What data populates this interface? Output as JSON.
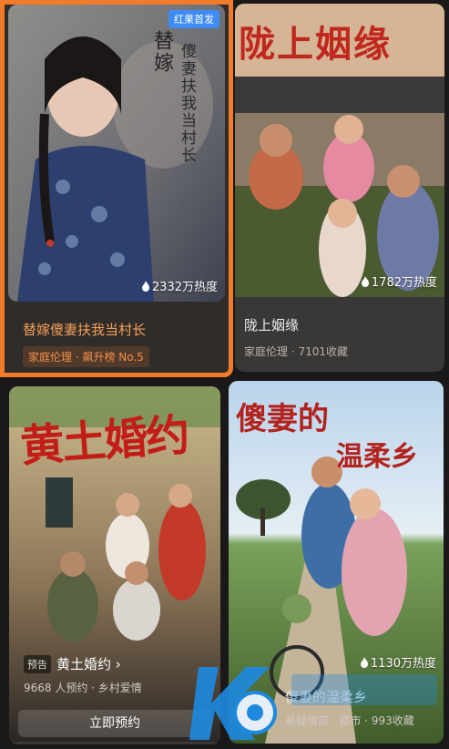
{
  "cards": [
    {
      "badge": "红果首发",
      "poster_title": "替嫁",
      "poster_subtitle": "傻妻扶我当村长",
      "heat": "2332万热度",
      "title": "替嫁傻妻扶我当村长",
      "meta": "家庭伦理 · 飙升榜 No.5"
    },
    {
      "poster_title": "陇上姻缘",
      "heat": "1782万热度",
      "title": "陇上姻缘",
      "meta": "家庭伦理 · 7101收藏"
    },
    {
      "poster_title": "黄土婚约",
      "tag": "预告",
      "title": "黄土婚约 ›",
      "meta": "9668 人预约 · 乡村爱情",
      "button": "立即预约"
    },
    {
      "poster_title_1": "傻妻的",
      "poster_title_2": "温柔乡",
      "heat": "1130万热度",
      "title": "傻妻的温柔乡",
      "meta": "悬疑情感 · 都市 · 993收藏"
    }
  ],
  "colors": {
    "accent": "#f27a2b",
    "badge": "#3f8cf5",
    "card_bg": "#3a3837"
  },
  "icons": [
    "flame-icon",
    "chevron-right-icon"
  ]
}
